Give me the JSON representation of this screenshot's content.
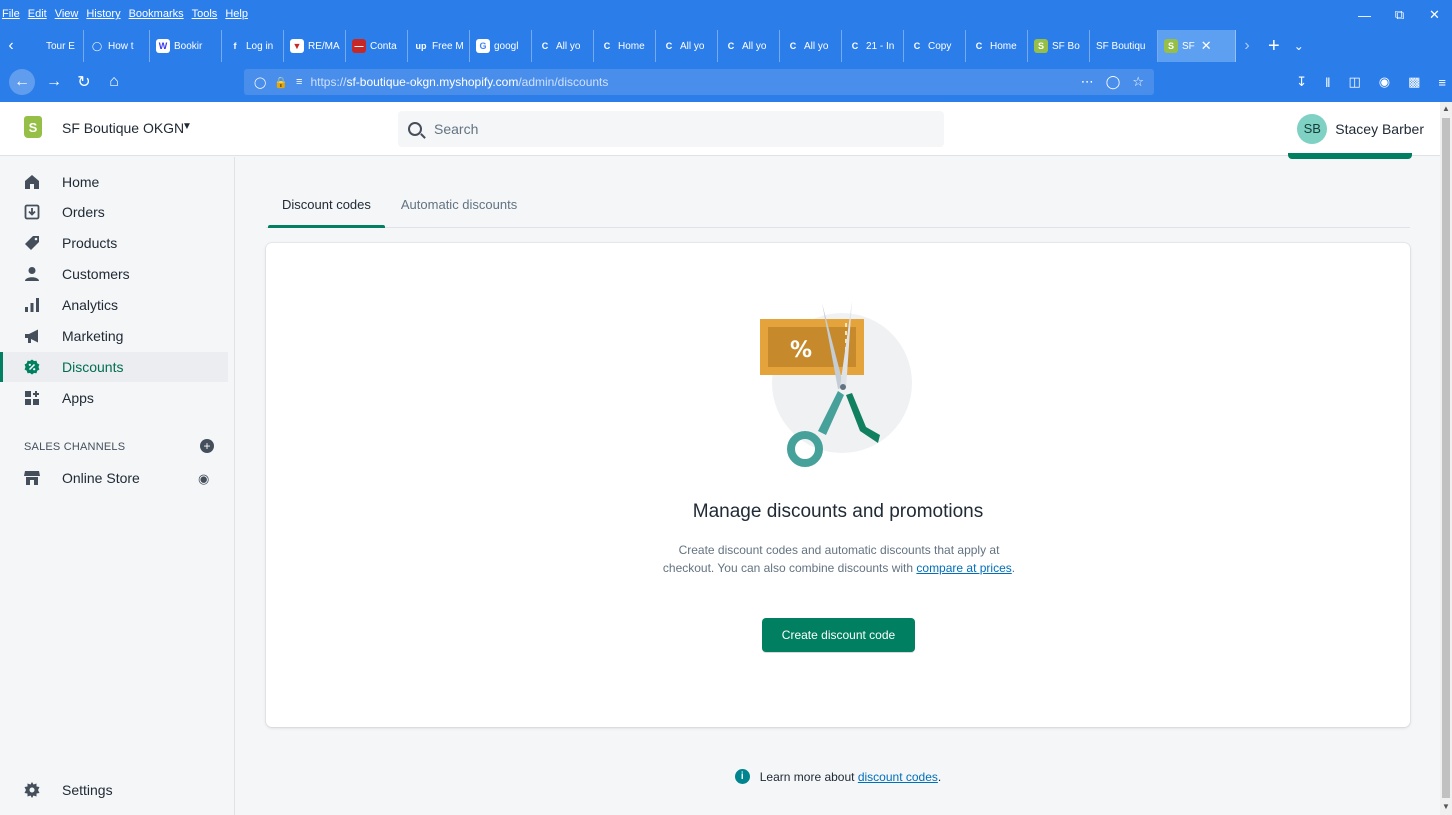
{
  "browser": {
    "menu": [
      "File",
      "Edit",
      "View",
      "History",
      "Bookmarks",
      "Tools",
      "Help"
    ],
    "tabs": [
      {
        "label": "Tour E",
        "icon": "ig-icon",
        "color": "#ffffff"
      },
      {
        "label": "How t",
        "icon": "circle-icon",
        "color": "#4fc3f7"
      },
      {
        "label": "Bookir",
        "icon": "w-icon",
        "color": "#ffffff"
      },
      {
        "label": "Log in",
        "icon": "facebook-icon",
        "color": "#1877f2"
      },
      {
        "label": "RE/MA",
        "icon": "remax-icon",
        "color": "#ffffff"
      },
      {
        "label": "Conta",
        "icon": "contact-icon",
        "color": "#c62828"
      },
      {
        "label": "Free M",
        "icon": "upwork-icon",
        "color": "#6fda44"
      },
      {
        "label": "googl",
        "icon": "google-icon",
        "color": "#ffffff"
      },
      {
        "label": "All yo",
        "icon": "c-icon",
        "color": "#ffffff"
      },
      {
        "label": "Home",
        "icon": "c-icon",
        "color": "#ffffff"
      },
      {
        "label": "All yo",
        "icon": "c-icon",
        "color": "#ffffff"
      },
      {
        "label": "All yo",
        "icon": "c-icon",
        "color": "#ffffff"
      },
      {
        "label": "All yo",
        "icon": "c-icon",
        "color": "#ffffff"
      },
      {
        "label": "21 - In",
        "icon": "c-icon",
        "color": "#ffffff"
      },
      {
        "label": "Copy",
        "icon": "c-icon",
        "color": "#ffffff"
      },
      {
        "label": "Home",
        "icon": "c-icon",
        "color": "#ffffff"
      },
      {
        "label": "SF Bo",
        "icon": "shopify-icon",
        "color": "#95bf47"
      },
      {
        "label": "SF Boutiqu",
        "icon": "",
        "color": "#ffffff"
      },
      {
        "label": "SF",
        "icon": "shopify-icon",
        "color": "#95bf47"
      }
    ],
    "url_prefix": "https://",
    "url_host": "sf-boutique-okgn.myshopify.com",
    "url_path": "/admin/discounts"
  },
  "header": {
    "shop_name": "SF Boutique OKGN",
    "search_placeholder": "Search",
    "user_initials": "SB",
    "user_name": "Stacey Barber"
  },
  "sidebar": {
    "items": [
      {
        "label": "Home",
        "icon": "home-icon"
      },
      {
        "label": "Orders",
        "icon": "orders-icon"
      },
      {
        "label": "Products",
        "icon": "tag-icon"
      },
      {
        "label": "Customers",
        "icon": "person-icon"
      },
      {
        "label": "Analytics",
        "icon": "bar-chart-icon"
      },
      {
        "label": "Marketing",
        "icon": "megaphone-icon"
      },
      {
        "label": "Discounts",
        "icon": "discount-icon"
      },
      {
        "label": "Apps",
        "icon": "apps-icon"
      }
    ],
    "active": "Discounts",
    "sales_channels_title": "SALES CHANNELS",
    "online_store_label": "Online Store",
    "settings_label": "Settings"
  },
  "main": {
    "tabs": [
      "Discount codes",
      "Automatic discounts"
    ],
    "active_tab": "Discount codes",
    "empty_title": "Manage discounts and promotions",
    "empty_desc_1": "Create discount codes and automatic discounts that apply at checkout. You can also combine discounts with ",
    "empty_desc_link": "compare at prices",
    "empty_desc_2": ".",
    "create_button": "Create discount code",
    "learn_prefix": "Learn more about ",
    "learn_link": "discount codes",
    "learn_suffix": "."
  },
  "colors": {
    "browser_blue": "#2b7de9",
    "primary_green": "#008060",
    "link_blue": "#006fbb",
    "coupon_orange": "#e4a43b",
    "scissors_teal": "#47a19b"
  }
}
